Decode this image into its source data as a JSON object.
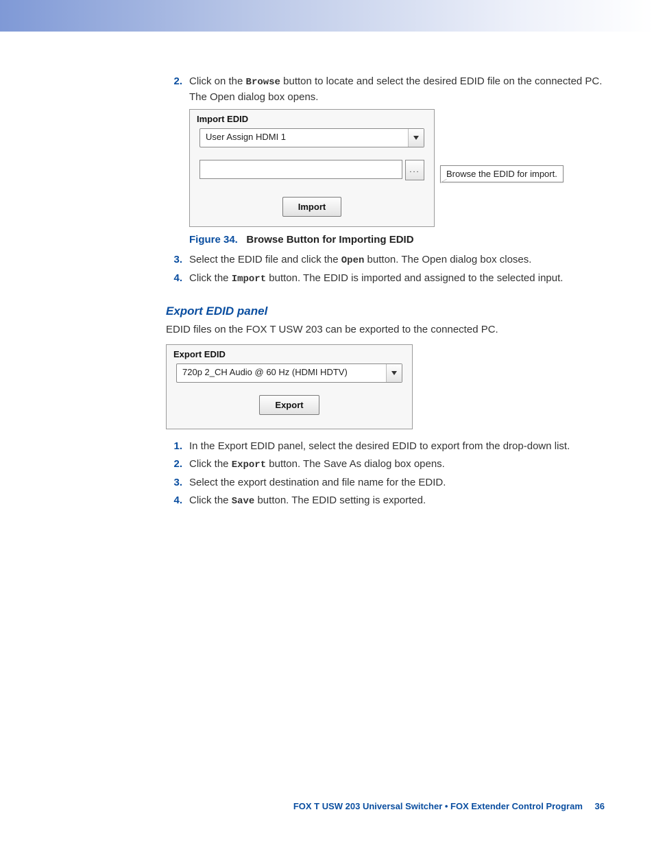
{
  "steps_a": {
    "s2": {
      "num": "2.",
      "pre": "Click on the ",
      "btn": "Browse",
      "post": " button to locate and select the desired EDID file on the connected PC. The Open dialog box opens."
    },
    "s3": {
      "num": "3.",
      "pre": "Select the EDID file and click the ",
      "btn": "Open",
      "post": " button. The Open dialog box closes."
    },
    "s4": {
      "num": "4.",
      "pre": "Click the ",
      "btn": "Import",
      "post": " button. The EDID is imported and assigned to the selected input."
    }
  },
  "import_panel": {
    "title": "Import EDID",
    "combo": "User Assign HDMI 1",
    "browse_ellipsis": "...",
    "import_label": "Import",
    "tooltip": "Browse the EDID for import."
  },
  "fig34": {
    "label": "Figure 34.",
    "title": "Browse Button for Importing EDID"
  },
  "section": {
    "heading": "Export EDID panel",
    "intro": "EDID files on the FOX T USW 203 can be exported to the connected PC."
  },
  "export_panel": {
    "title": "Export EDID",
    "combo": "720p 2_CH Audio @ 60 Hz (HDMI HDTV)",
    "export_label": "Export"
  },
  "steps_b": {
    "s1": {
      "num": "1.",
      "text": "In the Export EDID panel, select the desired EDID to export from the drop-down list."
    },
    "s2": {
      "num": "2.",
      "pre": "Click the ",
      "btn": "Export",
      "post": " button. The Save As dialog box opens."
    },
    "s3": {
      "num": "3.",
      "text": "Select the export destination and file name for the EDID."
    },
    "s4": {
      "num": "4.",
      "pre": "Click the ",
      "btn": "Save",
      "post": " button. The EDID setting is exported."
    }
  },
  "footer": {
    "text": "FOX T USW 203 Universal Switcher • FOX Extender Control Program",
    "page": "36"
  }
}
